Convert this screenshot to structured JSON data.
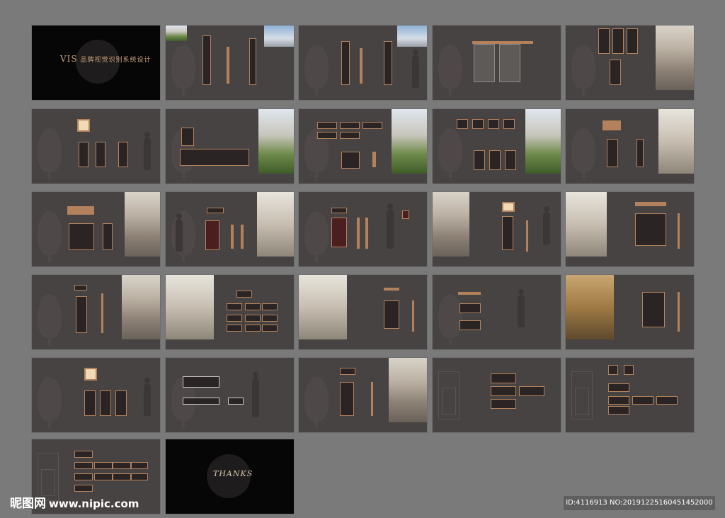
{
  "cover": {
    "brand": "VIS",
    "title": "品牌视觉识别系统设计"
  },
  "closing": {
    "text": "THANKS"
  },
  "watermark": {
    "site_cn": "昵图网",
    "site_url": "www.nipic.com"
  },
  "image_info": {
    "text": "ID:4116913 NO:20191225160451452000"
  },
  "colors": {
    "background": "#7a7a7a",
    "slide": "#474342",
    "accent_copper": "#b3825c"
  }
}
